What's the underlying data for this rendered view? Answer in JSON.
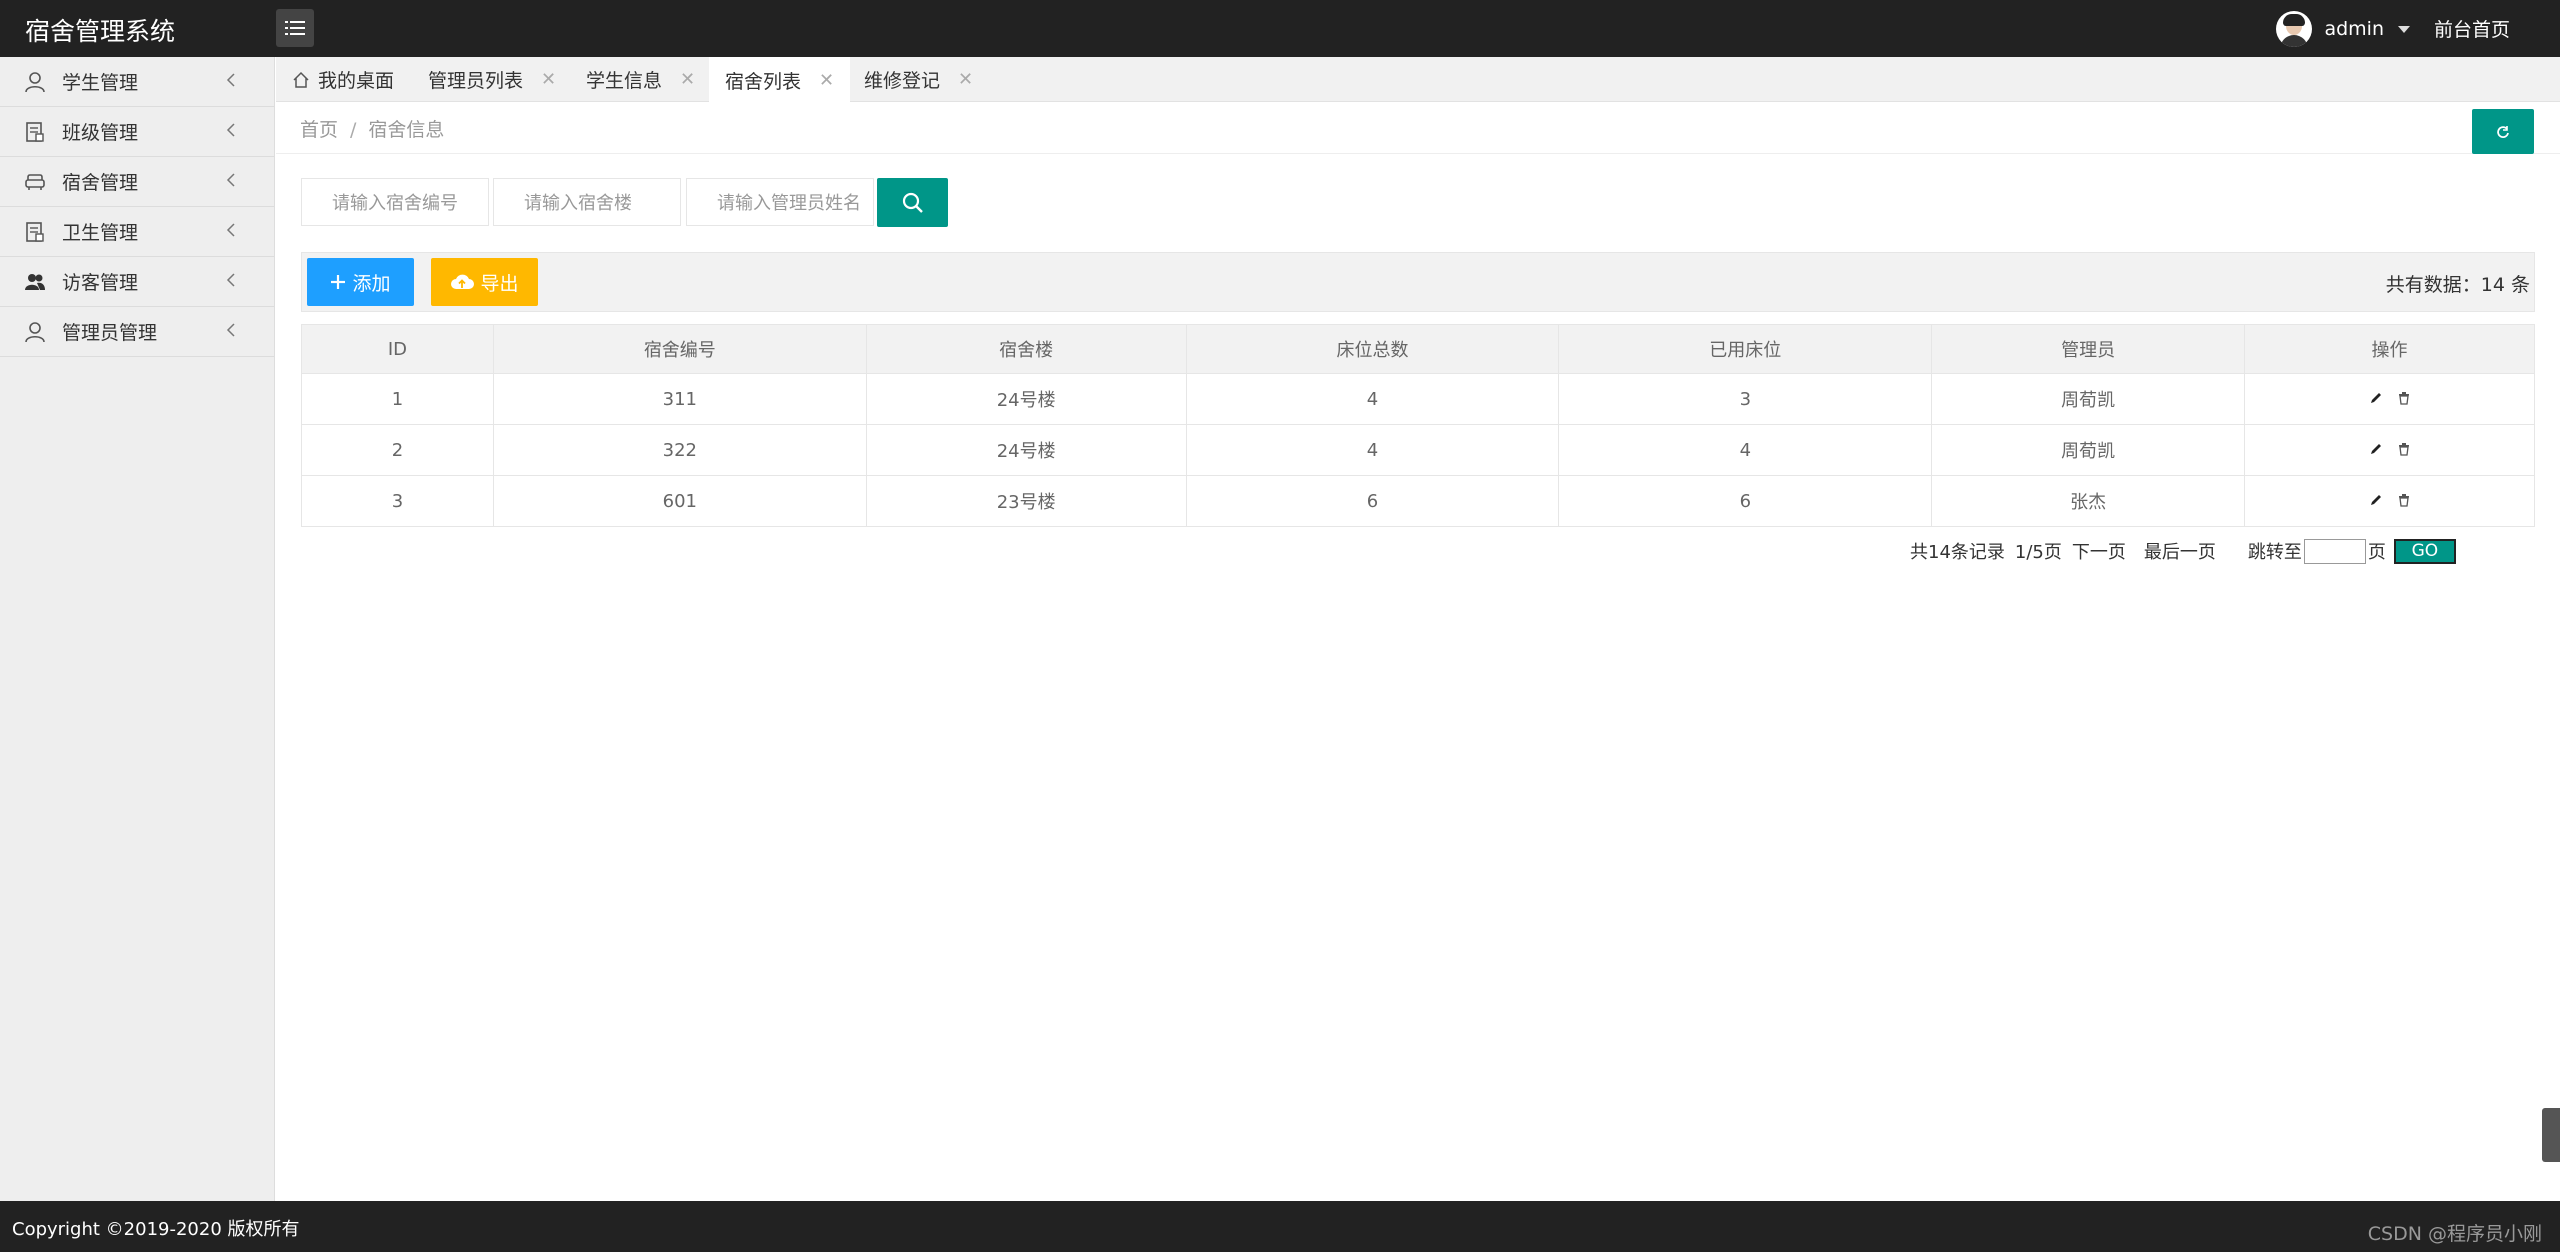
{
  "header": {
    "logo": "宿舍管理系统",
    "user": "admin",
    "front_home": "前台首页"
  },
  "sidebar": {
    "items": [
      {
        "label": "学生管理",
        "icon": "person-icon"
      },
      {
        "label": "班级管理",
        "icon": "document-icon"
      },
      {
        "label": "宿舍管理",
        "icon": "sofa-icon"
      },
      {
        "label": "卫生管理",
        "icon": "document-icon"
      },
      {
        "label": "访客管理",
        "icon": "users-icon"
      },
      {
        "label": "管理员管理",
        "icon": "person-icon"
      }
    ]
  },
  "tabs": [
    {
      "label": "我的桌面",
      "closable": false,
      "active": false
    },
    {
      "label": "管理员列表",
      "closable": true,
      "active": false
    },
    {
      "label": "学生信息",
      "closable": true,
      "active": false
    },
    {
      "label": "宿舍列表",
      "closable": true,
      "active": true
    },
    {
      "label": "维修登记",
      "closable": true,
      "active": false
    }
  ],
  "tab_close_glyph": "✕",
  "breadcrumb": {
    "home": "首页",
    "separator": "/",
    "current": "宿舍信息"
  },
  "search": {
    "dorm_no_placeholder": "请输入宿舍编号",
    "building_placeholder": "请输入宿舍楼",
    "manager_placeholder": "请输入管理员姓名"
  },
  "toolbar": {
    "add_label": "添加",
    "export_label": "导出",
    "total_text": "共有数据：14 条"
  },
  "table": {
    "headers": [
      "ID",
      "宿舍编号",
      "宿舍楼",
      "床位总数",
      "已用床位",
      "管理员",
      "操作"
    ],
    "rows": [
      [
        "1",
        "311",
        "24号楼",
        "4",
        "3",
        "周荀凯"
      ],
      [
        "2",
        "322",
        "24号楼",
        "4",
        "4",
        "周荀凯"
      ],
      [
        "3",
        "601",
        "23号楼",
        "6",
        "6",
        "张杰"
      ]
    ]
  },
  "pager": {
    "records": "共14条记录",
    "page_info": "1/5页",
    "next": "下一页",
    "last": "最后一页",
    "jump_to": "跳转至",
    "page_suffix": "页",
    "go": "GO"
  },
  "footer": {
    "copyright": "Copyright ©2019-2020 版权所有",
    "watermark": "CSDN @程序员小刚"
  },
  "colors": {
    "header_bg": "#222222",
    "primary_green": "#009688",
    "add_blue": "#1e9fff",
    "export_orange": "#ffb800"
  }
}
